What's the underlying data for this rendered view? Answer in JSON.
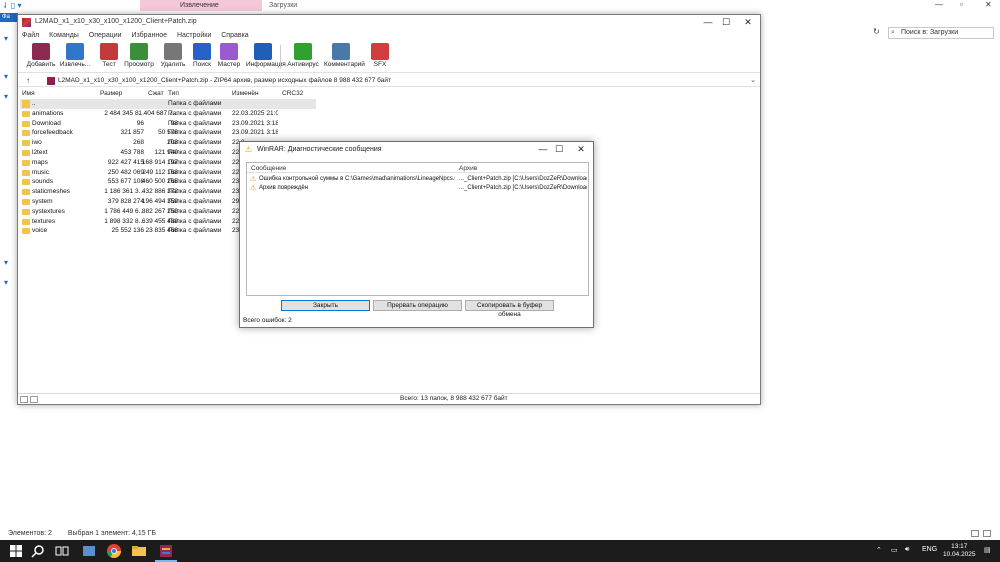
{
  "explorer": {
    "ribbon_tab_extract": "Извлечение",
    "ribbon_tab_downloads": "Загрузки",
    "ribbon_file_tab": "Фа",
    "search_placeholder": "Поиск в: Загрузки",
    "status_items_count": "Элементов: 2",
    "status_selected": "Выбран 1 элемент: 4,15 ГБ"
  },
  "winrar": {
    "title": "L2MAD_x1_x10_x30_x100_x1200_Client+Patch.zip",
    "menu": [
      "Файл",
      "Команды",
      "Операции",
      "Избранное",
      "Настройки",
      "Справка"
    ],
    "toolbar": [
      {
        "label": "Добавить",
        "icon": "add-archive-icon",
        "color": "#8e2a52"
      },
      {
        "label": "Извлечь...",
        "icon": "extract-folder-icon",
        "color": "#2f78c9"
      },
      {
        "label": "Тест",
        "icon": "test-icon",
        "color": "#c23a3a"
      },
      {
        "label": "Просмотр",
        "icon": "view-book-icon",
        "color": "#3a8f3a"
      },
      {
        "label": "Удалить",
        "icon": "delete-trash-icon",
        "color": "#777777"
      },
      {
        "label": "Поиск",
        "icon": "find-magnifier-icon",
        "color": "#2563c9"
      },
      {
        "label": "Мастер",
        "icon": "wizard-wand-icon",
        "color": "#9a5bd1"
      },
      {
        "label": "Информация",
        "icon": "info-icon",
        "color": "#1e5fb8"
      },
      {
        "label": "Антивирус",
        "icon": "antivirus-icon",
        "color": "#2ea12e"
      },
      {
        "label": "Комментарий",
        "icon": "comment-icon",
        "color": "#4a78a8"
      },
      {
        "label": "SFX",
        "icon": "sfx-books-icon",
        "color": "#d13c3c"
      }
    ],
    "address": "L2MAD_x1_x10_x30_x100_x1200_Client+Patch.zip - ZIP64 архив, размер исходных файлов 8 988 432 677 байт",
    "columns": [
      "Имя",
      "Размер",
      "Сжат",
      "Тип",
      "Изменён",
      "CRC32"
    ],
    "rows": [
      {
        "name": "..",
        "size": "",
        "packed": "",
        "type": "Папка с файлами",
        "modified": ""
      },
      {
        "name": "animations",
        "size": "2 484 345 8...",
        "packed": "1 404 687 7...",
        "type": "Папка с файлами",
        "modified": "22.03.2025 21:01"
      },
      {
        "name": "Download",
        "size": "96",
        "packed": "93",
        "type": "Папка с файлами",
        "modified": "23.09.2021 3:18"
      },
      {
        "name": "forcefeedback",
        "size": "321 857",
        "packed": "50 576",
        "type": "Папка с файлами",
        "modified": "23.09.2021 3:18"
      },
      {
        "name": "iwo",
        "size": "268",
        "packed": "203",
        "type": "Папка с файлами",
        "modified": "22.0..."
      },
      {
        "name": "l2text",
        "size": "453 788",
        "packed": "121 940",
        "type": "Папка с файлами",
        "modified": "22.0..."
      },
      {
        "name": "maps",
        "size": "922 427 415",
        "packed": "168 914 197",
        "type": "Папка с файлами",
        "modified": "22.0..."
      },
      {
        "name": "music",
        "size": "250 482 069",
        "packed": "249 112 163",
        "type": "Папка с файлами",
        "modified": "22.0..."
      },
      {
        "name": "sounds",
        "size": "553 677 108",
        "packed": "460 500 265",
        "type": "Папка с файлами",
        "modified": "23.0..."
      },
      {
        "name": "staticmeshes",
        "size": "1 186 361 3...",
        "packed": "432 886 372",
        "type": "Папка с файлами",
        "modified": "23.0..."
      },
      {
        "name": "system",
        "size": "379 828 274",
        "packed": "196 494 359",
        "type": "Папка с файлами",
        "modified": "29.1..."
      },
      {
        "name": "systextures",
        "size": "1 786 449 6...",
        "packed": "882 267 250",
        "type": "Папка с файлами",
        "modified": "22.0..."
      },
      {
        "name": "textures",
        "size": "1 898 332 8...",
        "packed": "639 455 489",
        "type": "Папка с файлами",
        "modified": "22.0..."
      },
      {
        "name": "voice",
        "size": "25 552 136",
        "packed": "23 835 466",
        "type": "Папка с файлами",
        "modified": "23.0..."
      }
    ],
    "status": "Всего: 13 папок, 8 988 432 677 байт"
  },
  "dialog": {
    "title": "WinRAR: Диагностические сообщения",
    "col_message": "Сообщение",
    "col_archive": "Архив",
    "messages": [
      {
        "message": "Ошибка контрольной суммы в C:\\Games\\mad\\animations\\LineageNpcs.uk...",
        "archive": "..._Client+Patch.zip [C:\\Users\\DozZeR\\Downloads"
      },
      {
        "message": "Архив повреждён",
        "archive": "..._Client+Patch.zip [C:\\Users\\DozZeR\\Downloads"
      }
    ],
    "btn_close": "Закрыть",
    "btn_abort": "Прервать операцию",
    "btn_copy": "Скопировать в буфер обмена",
    "errors_total": "Всего ошибок: 2"
  },
  "taskbar": {
    "lang": "ENG",
    "time": "13:17",
    "date": "10.04.2025"
  }
}
